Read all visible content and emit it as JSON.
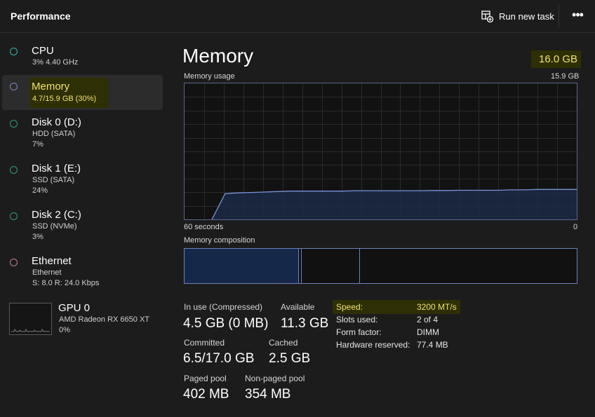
{
  "app": {
    "title": "Performance"
  },
  "toolbar": {
    "run_task_label": "Run new task",
    "more_label": "•••"
  },
  "sidebar": {
    "items": [
      {
        "name": "CPU",
        "sub1": "3%  4.40 GHz",
        "sub2": "",
        "sub3": "",
        "color": "#3fb0b0"
      },
      {
        "name": "Memory",
        "sub1": "4.7/15.9 GB (30%)",
        "sub2": "",
        "sub3": "",
        "color": "#7a86c6"
      },
      {
        "name": "Disk 0 (D:)",
        "sub1": "HDD (SATA)",
        "sub2": "7%",
        "sub3": "",
        "color": "#2f9a7a"
      },
      {
        "name": "Disk 1 (E:)",
        "sub1": "SSD (SATA)",
        "sub2": "24%",
        "sub3": "",
        "color": "#2f9a7a"
      },
      {
        "name": "Disk 2 (C:)",
        "sub1": "SSD (NVMe)",
        "sub2": "3%",
        "sub3": "",
        "color": "#2f9a7a"
      },
      {
        "name": "Ethernet",
        "sub1": "Ethernet",
        "sub2": "S: 8.0  R: 24.0 Kbps",
        "sub3": "",
        "color": "#c77aa6"
      },
      {
        "name": "GPU 0",
        "sub1": "AMD Radeon RX 6650 XT",
        "sub2": "0%",
        "sub3": "",
        "color": ""
      }
    ]
  },
  "main": {
    "title": "Memory",
    "total": "16.0 GB",
    "usage_label": "Memory usage",
    "usage_max": "15.9 GB",
    "axis_left": "60 seconds",
    "axis_right": "0",
    "composition_label": "Memory composition",
    "stats": {
      "in_use_label": "In use (Compressed)",
      "in_use_value": "4.5 GB (0 MB)",
      "available_label": "Available",
      "available_value": "11.3 GB",
      "committed_label": "Committed",
      "committed_value": "6.5/17.0 GB",
      "cached_label": "Cached",
      "cached_value": "2.5 GB",
      "paged_label": "Paged pool",
      "paged_value": "402 MB",
      "nonpaged_label": "Non-paged pool",
      "nonpaged_value": "354 MB"
    },
    "details": [
      {
        "key": "Speed:",
        "value": "3200 MT/s",
        "highlight": true
      },
      {
        "key": "Slots used:",
        "value": "2 of 4",
        "highlight": false
      },
      {
        "key": "Form factor:",
        "value": "DIMM",
        "highlight": false
      },
      {
        "key": "Hardware reserved:",
        "value": "77.4 MB",
        "highlight": false
      }
    ]
  },
  "chart_data": {
    "type": "area",
    "title": "Memory usage",
    "xlabel": "",
    "ylabel": "",
    "x_range_label": [
      "60 seconds",
      "0"
    ],
    "ylim": [
      0,
      15.9
    ],
    "values": [
      0.0,
      3.0,
      3.1,
      3.15,
      3.2,
      3.25,
      3.3,
      3.3,
      3.3,
      3.3,
      3.3,
      3.35,
      3.35,
      3.35,
      3.35,
      3.35,
      3.35,
      3.38,
      3.38,
      3.4,
      3.4,
      3.4,
      3.4,
      3.45,
      3.45,
      3.5,
      3.5,
      3.5,
      3.5
    ],
    "grid": true,
    "line_color": "#7b93d6",
    "fill_color": "#1b2a46"
  },
  "composition_data": {
    "in_use_fraction": 0.29,
    "modified_fraction": 0.008,
    "standby_fraction": 0.15,
    "free_fraction": 0.552
  }
}
